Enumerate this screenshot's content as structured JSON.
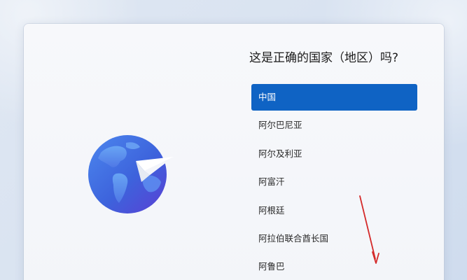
{
  "setup": {
    "question": "这是正确的国家（地区）吗?",
    "selected_index": 0,
    "countries": [
      {
        "label": "中国"
      },
      {
        "label": "阿尔巴尼亚"
      },
      {
        "label": "阿尔及利亚"
      },
      {
        "label": "阿富汗"
      },
      {
        "label": "阿根廷"
      },
      {
        "label": "阿拉伯联合酋长国"
      },
      {
        "label": "阿鲁巴"
      }
    ]
  },
  "icons": {
    "illustration": "globe-with-paper-plane-icon",
    "annotation": "red-arrow-down-icon"
  },
  "colors": {
    "selected_background": "#0f63c4",
    "selected_text": "#ffffff",
    "annotation_arrow": "#d42a2a",
    "globe_blue": "#3d73e0",
    "globe_purple": "#5a45d8"
  }
}
